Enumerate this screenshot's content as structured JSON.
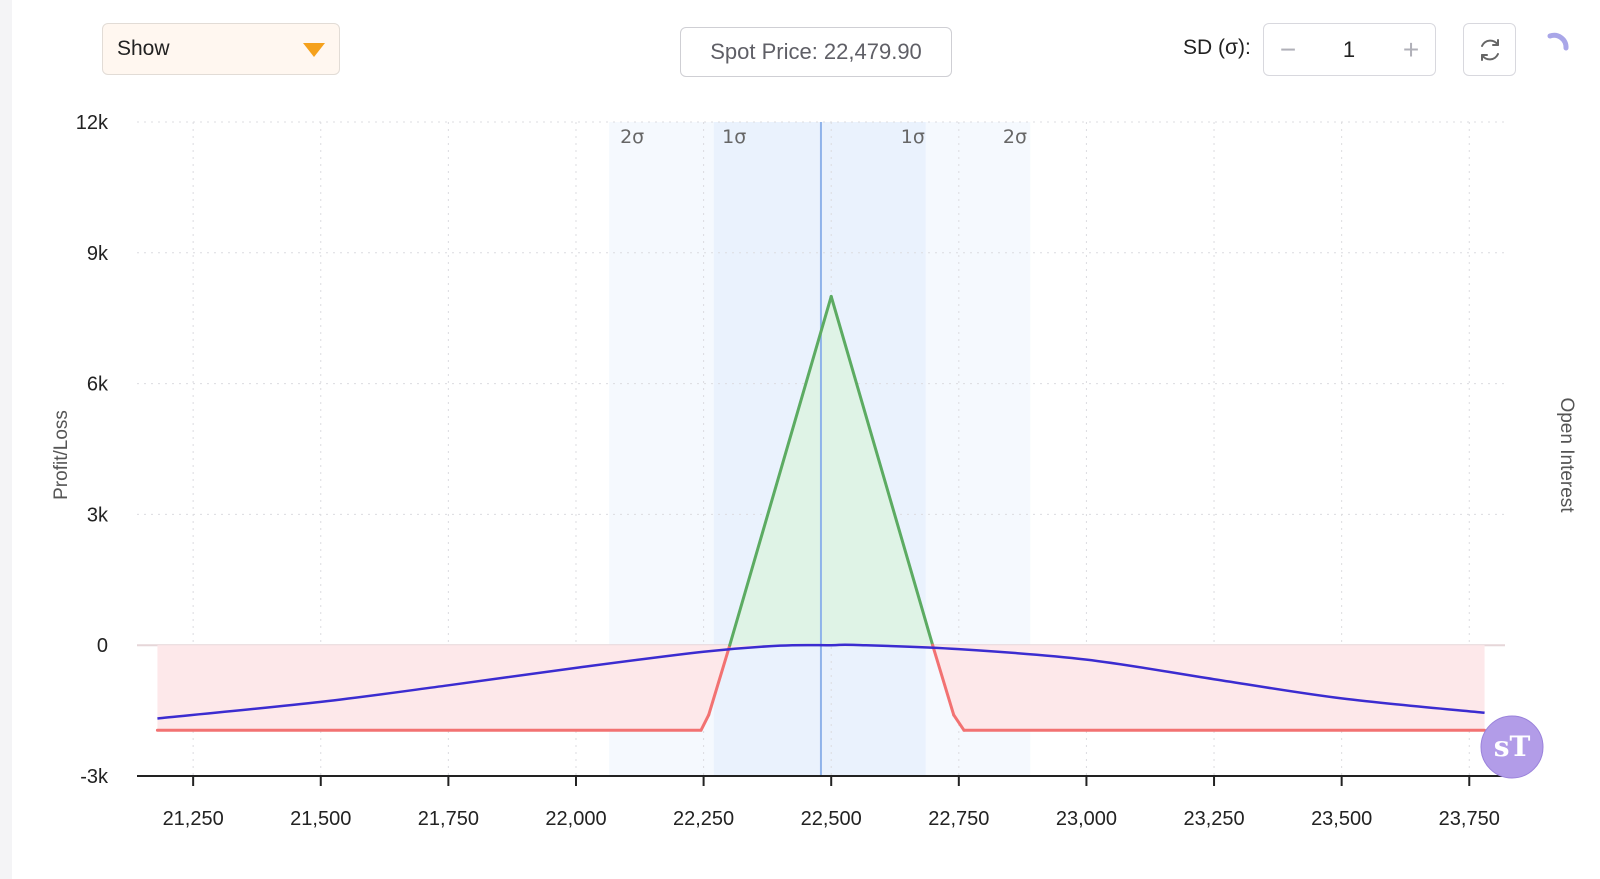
{
  "toolbar": {
    "dropdown_label": "Show",
    "spot_price_label": "Spot Price: 22,479.90",
    "sd_label": "SD (σ):",
    "sd_value": "1",
    "minus_label": "−",
    "plus_label": "+"
  },
  "icons": {
    "caret": "chevron-down-icon",
    "refresh": "refresh-icon",
    "spinner": "loading-spinner-icon",
    "logo": "brand-logo-icon"
  },
  "logo_text": "sT",
  "colors": {
    "profit": "#5cab62",
    "profit_fill": "#dff3e6",
    "loss": "#f27272",
    "loss_fill": "#fde8ea",
    "expiry_line": "#3b2cd0",
    "sigma1_band": "#eaf2fd",
    "sigma2_band": "#f5f9fe",
    "spot_line": "#8fb3ea",
    "accent": "#f5a11c"
  },
  "chart_data": {
    "type": "line",
    "ylabel": "Profit/Loss",
    "y2label": "Open Interest",
    "xlim": [
      21140,
      23820
    ],
    "ylim": [
      -3000,
      12000
    ],
    "x_ticks": [
      21250,
      21500,
      21750,
      22000,
      22250,
      22500,
      22750,
      23000,
      23250,
      23500,
      23750
    ],
    "x_tick_labels": [
      "21,250",
      "21,500",
      "21,750",
      "22,000",
      "22,250",
      "22,500",
      "22,750",
      "23,000",
      "23,250",
      "23,500",
      "23,750"
    ],
    "y_ticks": [
      -3000,
      0,
      3000,
      6000,
      9000,
      12000
    ],
    "y_tick_labels": [
      "-3k",
      "0",
      "3k",
      "6k",
      "9k",
      "12k"
    ],
    "spot_price": 22479.9,
    "sigma_bands": [
      {
        "label": "2σ",
        "from": 22065,
        "to": 22270,
        "level": 2
      },
      {
        "label": "1σ",
        "from": 22270,
        "to": 22685,
        "level": 1
      },
      {
        "label": "1σ",
        "from": 22685,
        "to": 22890,
        "level": 1
      },
      {
        "label": "2σ",
        "from": 22890,
        "to": 22890,
        "level": 2
      }
    ],
    "sigma_labels": [
      {
        "label": "2σ",
        "x": 22110
      },
      {
        "label": "1σ",
        "x": 22310
      },
      {
        "label": "1σ",
        "x": 22660
      },
      {
        "label": "2σ",
        "x": 22860
      }
    ],
    "sigma_ranges": {
      "one": [
        22270,
        22685
      ],
      "two": [
        22065,
        22890
      ]
    },
    "series": [
      {
        "role": "payoff_at_expiry",
        "x": [
          21180,
          22245,
          22260,
          22300,
          22500,
          22700,
          22740,
          22760,
          23780
        ],
        "y": [
          -1950,
          -1950,
          -1600,
          -50,
          8000,
          -50,
          -1600,
          -1950,
          -1950
        ]
      },
      {
        "role": "payoff_today",
        "x": [
          21180,
          21500,
          21750,
          22000,
          22250,
          22400,
          22500,
          22550,
          22750,
          23000,
          23250,
          23500,
          23780
        ],
        "y": [
          -1680,
          -1300,
          -920,
          -520,
          -150,
          -10,
          0,
          5,
          -90,
          -330,
          -780,
          -1220,
          -1550
        ]
      }
    ]
  }
}
